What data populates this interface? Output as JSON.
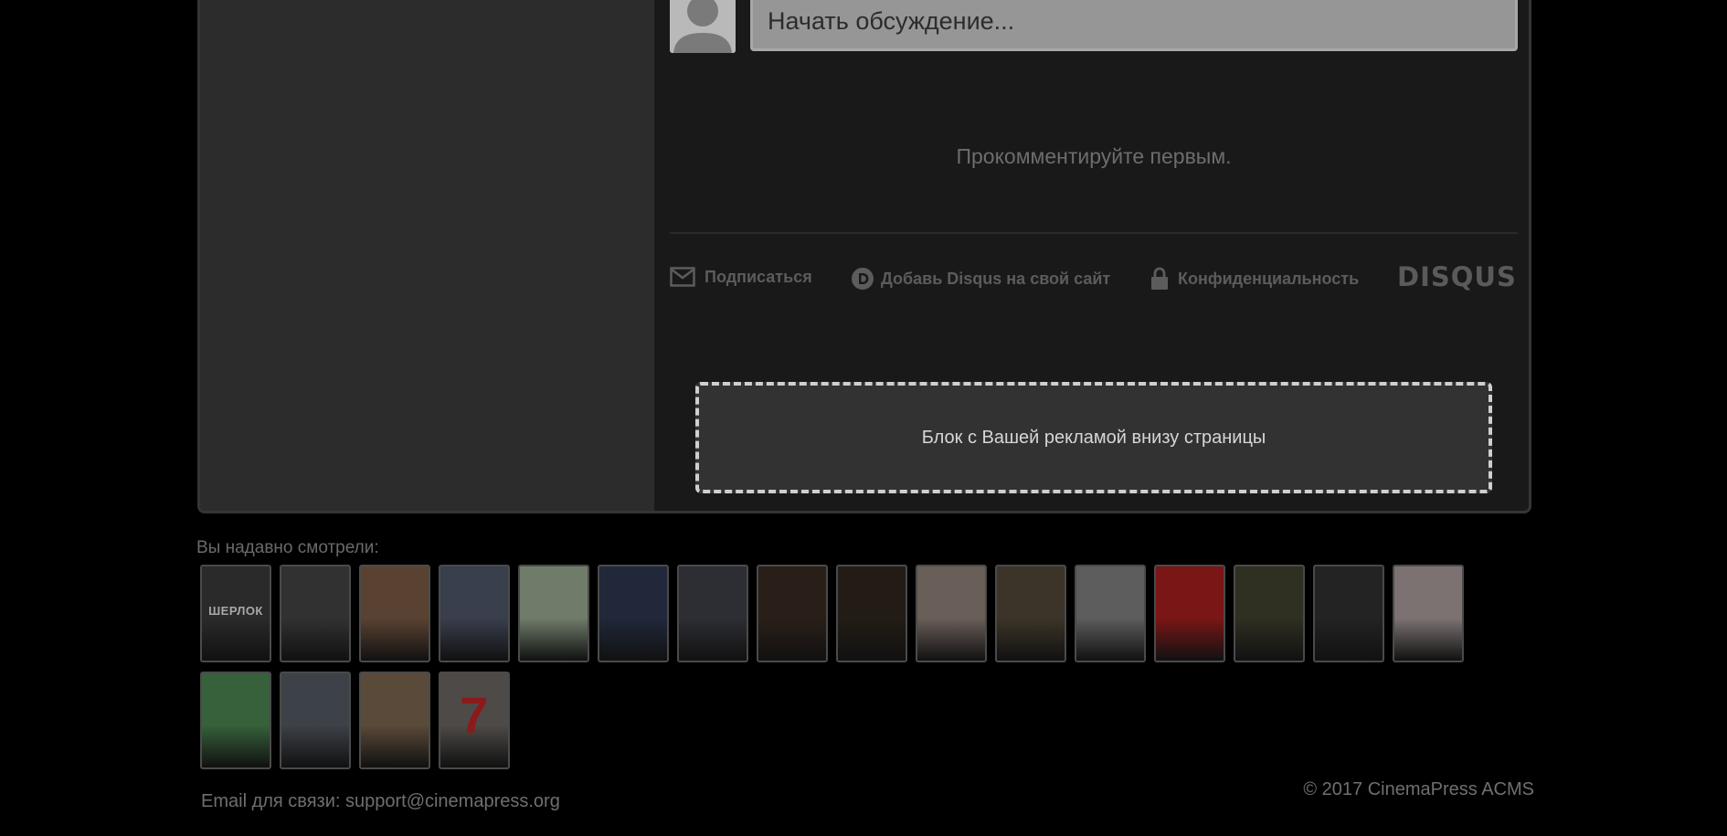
{
  "comments": {
    "input_placeholder": "Начать обсуждение...",
    "empty_message": "Прокомментируйте первым.",
    "subscribe_label": "Подписаться",
    "add_disqus_label": "Добавь Disqus на свой сайт",
    "privacy_label": "Конфиденциальность",
    "brand": "DISQUS"
  },
  "ad": {
    "text": "Блок с Вашей рекламой внизу страницы"
  },
  "recent": {
    "label": "Вы надавно смотрели:",
    "posters": [
      {
        "text": "ШЕРЛОК",
        "color": "#2a2a2a",
        "text_color": "#a9a9a9"
      },
      {
        "text": "",
        "color": "#313131",
        "text_color": "#888888"
      },
      {
        "text": "",
        "color": "#5a4232",
        "text_color": "#888888"
      },
      {
        "text": "",
        "color": "#3a3f4d",
        "text_color": "#888888"
      },
      {
        "text": "",
        "color": "#6f7c6a",
        "text_color": "#888888"
      },
      {
        "text": "",
        "color": "#20283a",
        "text_color": "#888888"
      },
      {
        "text": "",
        "color": "#2d2e33",
        "text_color": "#888888"
      },
      {
        "text": "",
        "color": "#2a1f18",
        "text_color": "#888888"
      },
      {
        "text": "",
        "color": "#231c16",
        "text_color": "#888888"
      },
      {
        "text": "",
        "color": "#6a5e58",
        "text_color": "#888888"
      },
      {
        "text": "",
        "color": "#3c3428",
        "text_color": "#888888"
      },
      {
        "text": "",
        "color": "#5d5d5d",
        "text_color": "#888888"
      },
      {
        "text": "",
        "color": "#7a1616",
        "text_color": "#cfcfcf"
      },
      {
        "text": "",
        "color": "#2f2f22",
        "text_color": "#888888"
      },
      {
        "text": "",
        "color": "#232323",
        "text_color": "#888888"
      },
      {
        "text": "",
        "color": "#7c7272",
        "text_color": "#888888"
      },
      {
        "text": "",
        "color": "#36613a",
        "text_color": "#1b2b1b"
      },
      {
        "text": "",
        "color": "#3d4148",
        "text_color": "#888888"
      },
      {
        "text": "",
        "color": "#5a4a39",
        "text_color": "#888888"
      },
      {
        "text": "7",
        "color": "#4e4a47",
        "text_color": "#8b1a1a"
      }
    ]
  },
  "footer": {
    "email_line": "Email для связи: support@cinemapress.org",
    "copyright": "© 2017 CinemaPress ACMS"
  }
}
